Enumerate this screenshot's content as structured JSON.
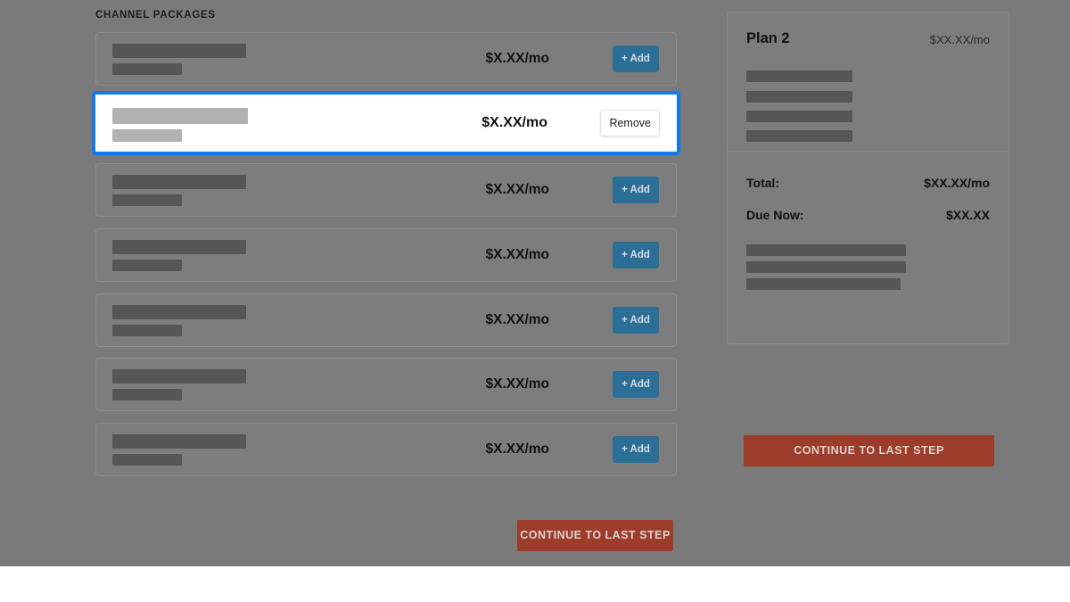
{
  "section": {
    "label": "CHANNEL PACKAGES"
  },
  "colors": {
    "overlay": "#7a7a7a",
    "selection_border": "#1578e8",
    "add_button": "#2b6e96",
    "continue_button": "#9c3c2a",
    "skeleton_dark": "#565656",
    "skeleton_light": "#b1b1b1"
  },
  "packages": [
    {
      "price": "$X.XX/mo",
      "action_label": "+ Add",
      "selected": false
    },
    {
      "price": "$X.XX/mo",
      "action_label": "Remove",
      "selected": true
    },
    {
      "price": "$X.XX/mo",
      "action_label": "+ Add",
      "selected": false
    },
    {
      "price": "$X.XX/mo",
      "action_label": "+ Add",
      "selected": false
    },
    {
      "price": "$X.XX/mo",
      "action_label": "+ Add",
      "selected": false
    },
    {
      "price": "$X.XX/mo",
      "action_label": "+ Add",
      "selected": false
    },
    {
      "price": "$X.XX/mo",
      "action_label": "+ Add",
      "selected": false
    }
  ],
  "main_action": {
    "continue_label": "CONTINUE TO LAST STEP"
  },
  "summary": {
    "plan_name": "Plan 2",
    "plan_price": "$XX.XX/mo",
    "totals": [
      {
        "label": "Total:",
        "value": "$XX.XX/mo"
      },
      {
        "label": "Due Now:",
        "value": "$XX.XX"
      }
    ],
    "continue_label": "CONTINUE TO LAST STEP"
  }
}
